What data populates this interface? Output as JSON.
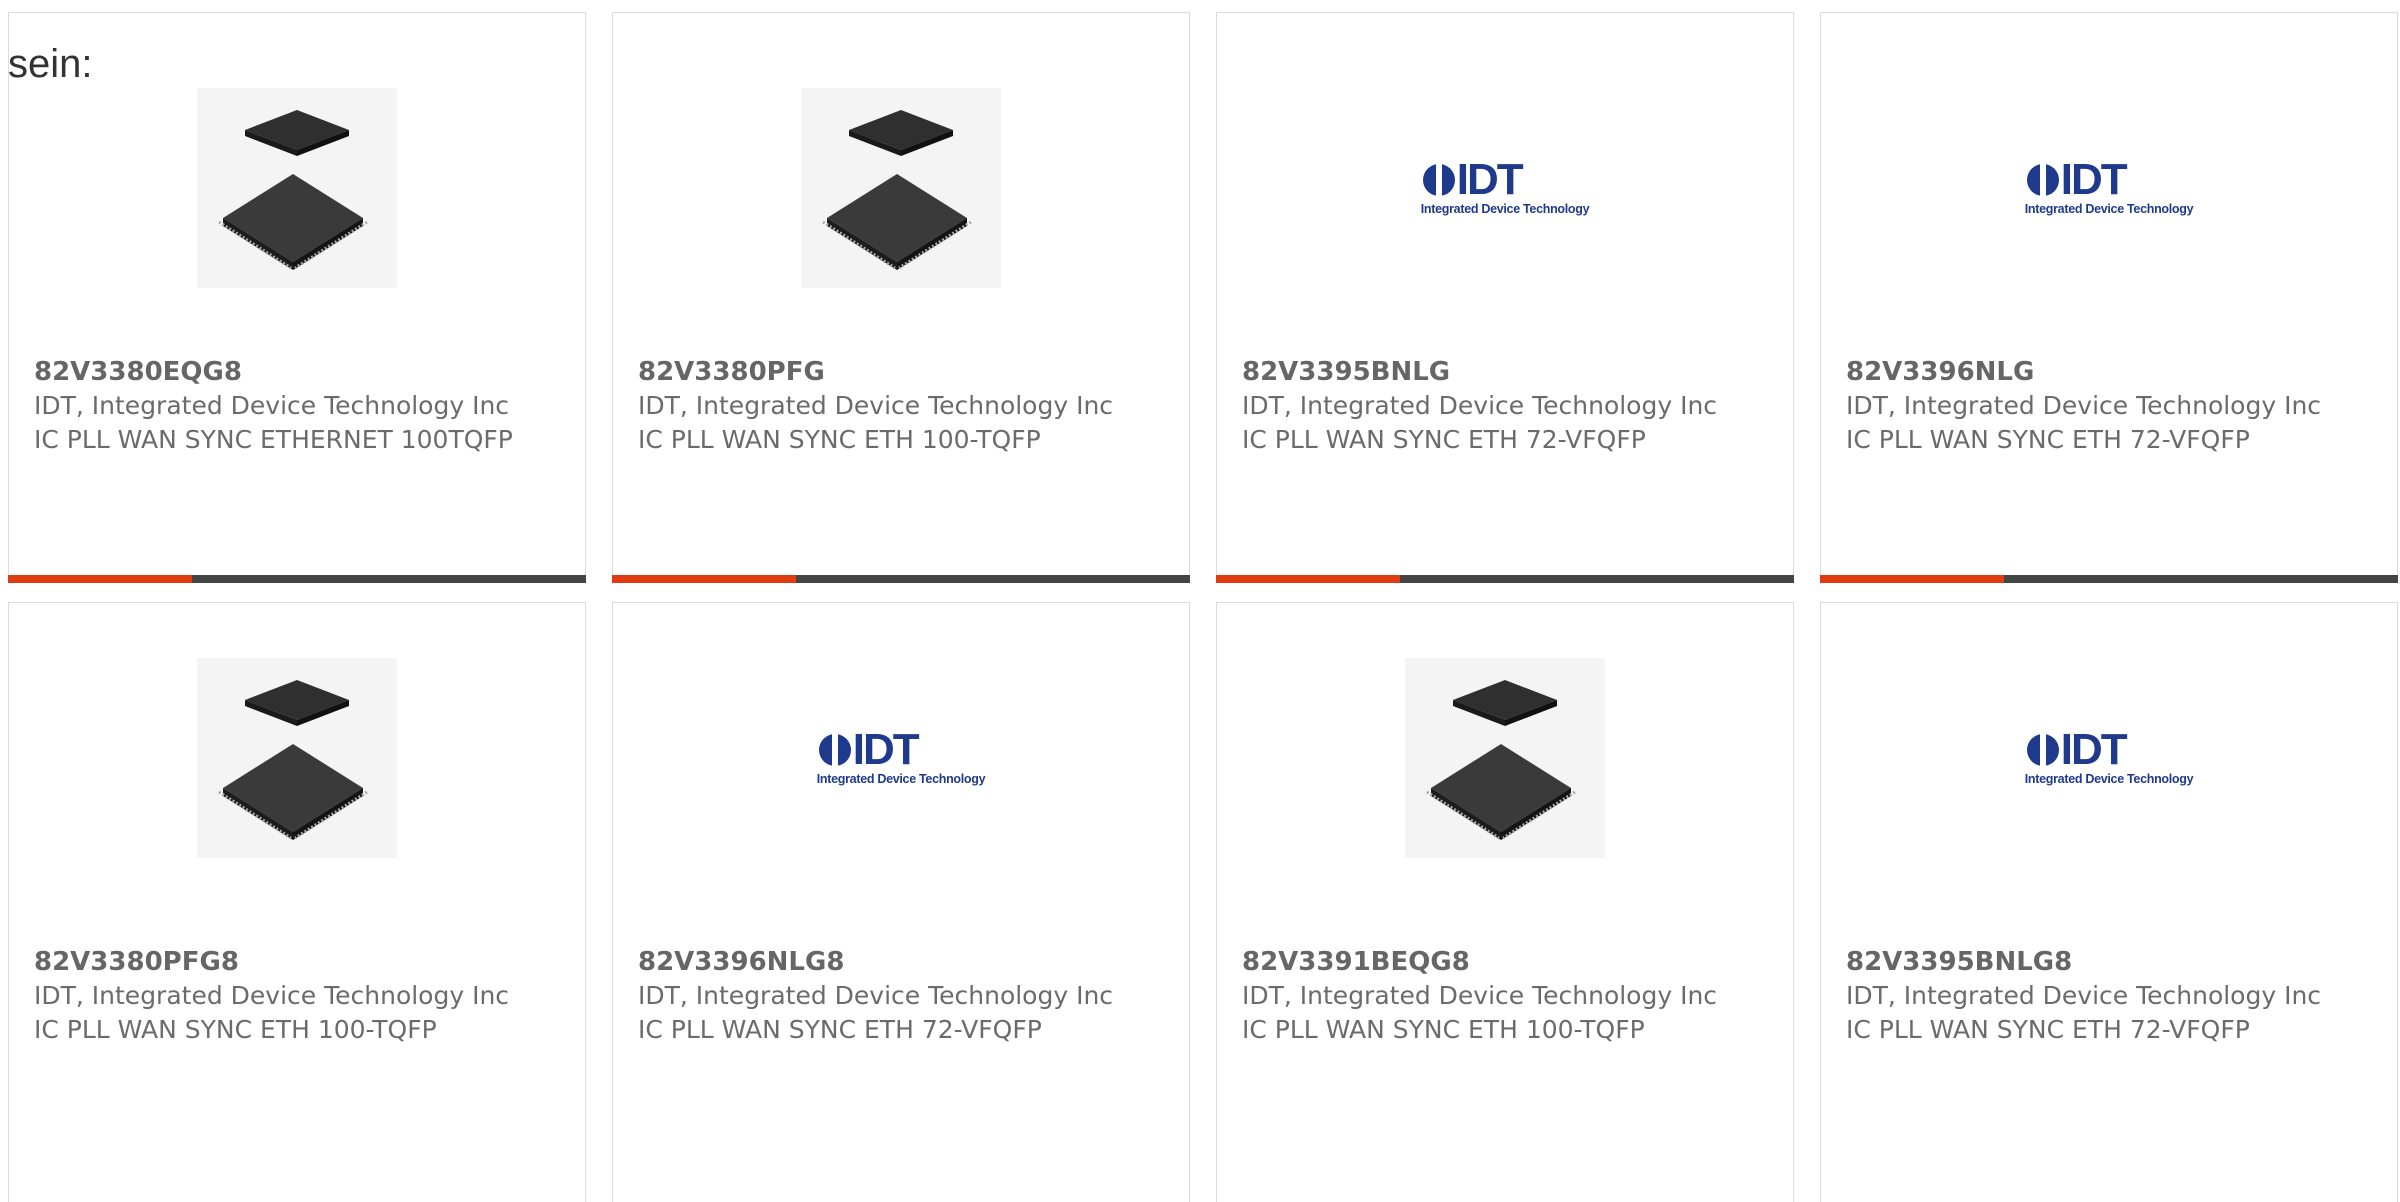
{
  "header": {
    "prefix": "sein:"
  },
  "cards": [
    {
      "part": "82V3380EQG8",
      "manufacturer": "IDT, Integrated Device Technology Inc",
      "description": "IC PLL WAN SYNC ETHERNET 100TQFP",
      "image": "chip-package-icon"
    },
    {
      "part": "82V3380PFG",
      "manufacturer": "IDT, Integrated Device Technology Inc",
      "description": "IC PLL WAN SYNC ETH 100-TQFP",
      "image": "chip-package-icon"
    },
    {
      "part": "82V3395BNLG",
      "manufacturer": "IDT, Integrated Device Technology Inc",
      "description": "IC PLL WAN SYNC ETH 72-VFQFP",
      "image": "idt-logo"
    },
    {
      "part": "82V3396NLG",
      "manufacturer": "IDT, Integrated Device Technology Inc",
      "description": "IC PLL WAN SYNC ETH 72-VFQFP",
      "image": "idt-logo"
    },
    {
      "part": "82V3380PFG8",
      "manufacturer": "IDT, Integrated Device Technology Inc",
      "description": "IC PLL WAN SYNC ETH 100-TQFP",
      "image": "chip-package-icon"
    },
    {
      "part": "82V3396NLG8",
      "manufacturer": "IDT, Integrated Device Technology Inc",
      "description": "IC PLL WAN SYNC ETH 72-VFQFP",
      "image": "idt-logo"
    },
    {
      "part": "82V3391BEQG8",
      "manufacturer": "IDT, Integrated Device Technology Inc",
      "description": "IC PLL WAN SYNC ETH 100-TQFP",
      "image": "chip-package-icon"
    },
    {
      "part": "82V3395BNLG8",
      "manufacturer": "IDT, Integrated Device Technology Inc",
      "description": "IC PLL WAN SYNC ETH 72-VFQFP",
      "image": "idt-logo"
    }
  ],
  "logo": {
    "word": "IDT",
    "subtitle": "Integrated Device Technology"
  },
  "colors": {
    "accent": "#e03c12",
    "bar": "#444444",
    "logo": "#1f3a8c",
    "text": "#6b6b6b"
  }
}
